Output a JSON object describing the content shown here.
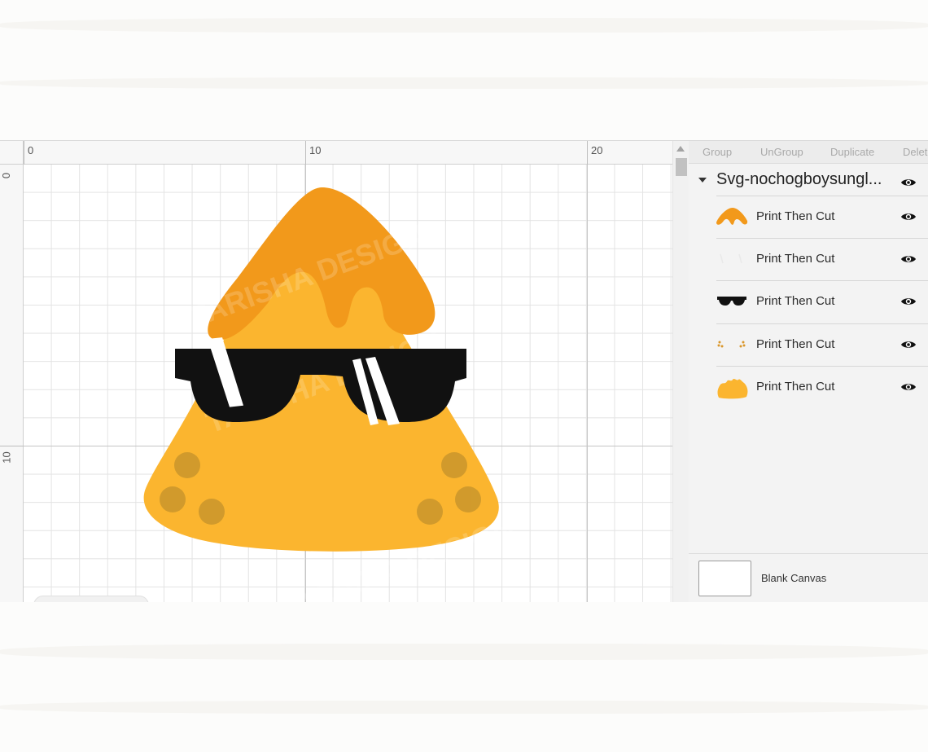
{
  "ruler": {
    "top_ticks": [
      "0",
      "10",
      "20"
    ],
    "left_ticks": [
      "0",
      "10"
    ]
  },
  "toolbar": {
    "group_label": "Group",
    "ungroup_label": "UnGroup",
    "duplicate_label": "Duplicate",
    "delete_label": "Delet"
  },
  "layers": {
    "group_name": "Svg-nochogboysungl...",
    "items": [
      {
        "label": "Print Then Cut",
        "thumb": "cheese-drip-thumb"
      },
      {
        "label": "Print Then Cut",
        "thumb": "glasses-shine-thumb"
      },
      {
        "label": "Print Then Cut",
        "thumb": "sunglasses-thumb"
      },
      {
        "label": "Print Then Cut",
        "thumb": "dots-thumb"
      },
      {
        "label": "Print Then Cut",
        "thumb": "nacho-chip-thumb"
      }
    ]
  },
  "canvas_footer": {
    "blank_label": "Blank Canvas"
  },
  "watermark": "TARISHA DESIGN",
  "colors": {
    "chip": "#fbb52f",
    "cheese": "#f2991b",
    "glasses": "#111111",
    "spots": "#c9962c"
  }
}
